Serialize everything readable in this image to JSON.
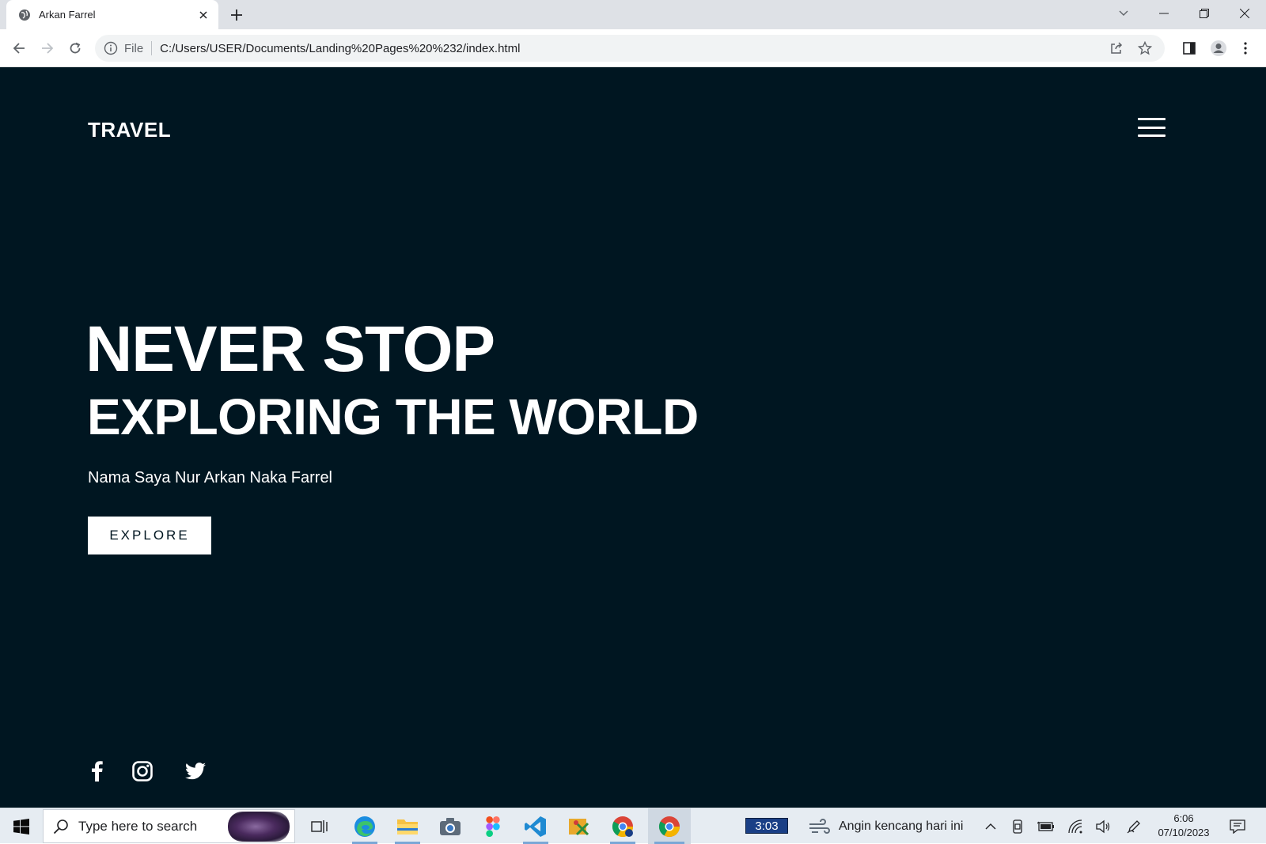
{
  "browser": {
    "tab_title": "Arkan Farrel",
    "url_scheme": "File",
    "url": "C:/Users/USER/Documents/Landing%20Pages%20%232/index.html"
  },
  "site": {
    "logo": "TRAVEL",
    "hero_line1": "NEVER STOP",
    "hero_line2": "EXPLORING THE WORLD",
    "subtitle": "Nama Saya Nur Arkan Naka Farrel",
    "explore_label": "EXPLORE",
    "social_icons": [
      "facebook-icon",
      "instagram-icon",
      "twitter-icon"
    ],
    "colors": {
      "background": "#001621",
      "text": "#ffffff",
      "button_bg": "#ffffff"
    }
  },
  "taskbar": {
    "search_placeholder": "Type here to search",
    "battery_badge": "3:03",
    "weather_text": "Angin kencang hari ini",
    "time": "6:06",
    "date": "07/10/2023",
    "pinned_apps": [
      "task-view-icon",
      "edge-icon",
      "file-explorer-icon",
      "camera-icon",
      "figma-icon",
      "vscode-icon",
      "snipping-tool-icon",
      "chrome-profile-icon",
      "chrome-icon"
    ]
  }
}
